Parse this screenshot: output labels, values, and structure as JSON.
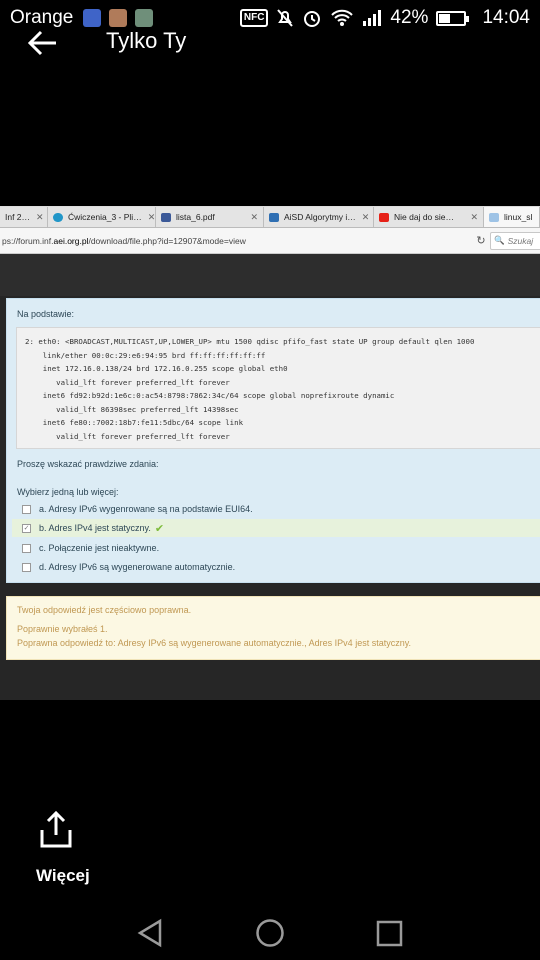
{
  "status_bar": {
    "carrier": "Orange",
    "battery": "42%",
    "time": "14:04",
    "nfc": "NFC",
    "icons": [
      "messenger-icon",
      "avatar-icon",
      "gallery-icon",
      "nfc-icon",
      "mute-icon",
      "alarm-icon",
      "wifi-icon",
      "signal-icon",
      "battery-icon"
    ]
  },
  "header": {
    "title": "Tylko Ty"
  },
  "browser": {
    "tabs": [
      {
        "label": "Inf 2…",
        "favicon_color": "#7a7a7a"
      },
      {
        "label": "Ćwiczenia_3 - Pli…",
        "favicon_color": "#2196c8"
      },
      {
        "label": "lista_6.pdf",
        "favicon_color": "#3b5998"
      },
      {
        "label": "AiSD Algorytmy i…",
        "favicon_color": "#2f6fb3"
      },
      {
        "label": "Nie daj do sie…",
        "favicon_color": "#e62117"
      },
      {
        "label": "linux_sl",
        "favicon_color": "#9ec3e6"
      }
    ],
    "url_prefix": "ps://forum.inf.",
    "url_domain": "aei.org.pl",
    "url_suffix": "/download/file.php?id=12907&mode=view",
    "search_placeholder": "Szukaj"
  },
  "question": {
    "intro": "Na podstawie:",
    "code": "2: eth0: <BROADCAST,MULTICAST,UP,LOWER_UP> mtu 1500 qdisc pfifo_fast state UP group default qlen 1000\n    link/ether 00:0c:29:e6:94:95 brd ff:ff:ff:ff:ff:ff\n    inet 172.16.0.138/24 brd 172.16.0.255 scope global eth0\n       valid_lft forever preferred_lft forever\n    inet6 fd92:b92d:1e6c:0:ac54:8798:7862:34c/64 scope global noprefixroute dynamic\n       valid_lft 86398sec preferred_lft 14398sec\n    inet6 fe80::7002:18b7:fe11:5dbc/64 scope link\n       valid_lft forever preferred_lft forever",
    "prompt": "Proszę wskazać prawdziwe zdania:",
    "choose": "Wybierz jedną lub więcej:",
    "options": [
      {
        "text": "a. Adresy IPv6 wygenrowane są na podstawie EUI64.",
        "checked": false
      },
      {
        "text": "b. Adres IPv4 jest statyczny.",
        "checked": true,
        "mark": "✔"
      },
      {
        "text": "c. Połączenie jest nieaktywne.",
        "checked": false
      },
      {
        "text": "d. Adresy IPv6 są wygenerowane automatycznie.",
        "checked": false
      }
    ]
  },
  "feedback": {
    "line1": "Twoja odpowiedź jest częściowo poprawna.",
    "line2": "Poprawnie wybrałeś 1.",
    "line3": "Poprawna odpowiedź to: Adresy IPv6 są wygenerowane automatycznie., Adres IPv4 jest statyczny."
  },
  "actions": {
    "more_label": "Więcej"
  },
  "colors": {
    "question_bg": "#dcecf5",
    "feedback_bg": "#fcf8e3",
    "feedback_text": "#c09853",
    "selected_bg": "#e7f2dc",
    "check_green": "#7dbb3a"
  }
}
